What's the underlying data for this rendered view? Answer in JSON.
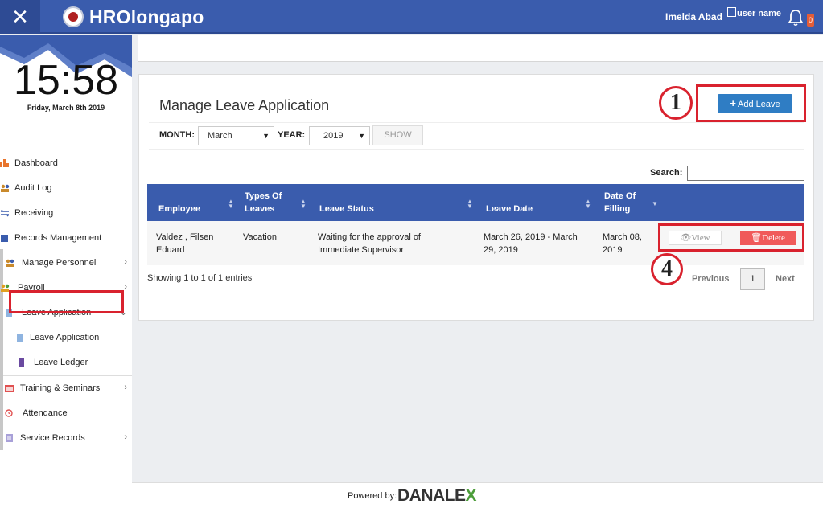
{
  "header": {
    "close_glyph": "✕",
    "app_title": "HROlongapo",
    "user_name": "Imelda Abad",
    "user_image_alt": "user name",
    "notification_count": "0"
  },
  "sidebar": {
    "clock": "15:58",
    "date": "Friday, March 8th 2019",
    "items": [
      {
        "label": "Dashboard",
        "icon": "chart-icon"
      },
      {
        "label": "Audit Log",
        "icon": "users-icon"
      },
      {
        "label": "Receiving",
        "icon": "swap-icon"
      },
      {
        "label": "Records Management",
        "icon": "folder-icon"
      },
      {
        "label": "Manage Personnel",
        "icon": "users-icon"
      },
      {
        "label": "Payroll",
        "icon": "users-icon"
      },
      {
        "label": "Leave Application",
        "icon": "document-icon"
      },
      {
        "label": "Leave Application",
        "icon": "document-icon"
      },
      {
        "label": "Leave Ledger",
        "icon": "book-icon"
      },
      {
        "label": "Training & Seminars",
        "icon": "calendar-icon"
      },
      {
        "label": "Attendance",
        "icon": "clock-icon"
      },
      {
        "label": "Service Records",
        "icon": "list-icon"
      }
    ]
  },
  "main": {
    "title": "Manage Leave Application",
    "add_button": "Add Leave",
    "annotations": [
      "1",
      "4"
    ],
    "filter": {
      "month_label": "MONTH:",
      "month_value": "March",
      "year_label": "YEAR:",
      "year_value": "2019",
      "show_button": "SHOW"
    },
    "search_label": "Search:",
    "table": {
      "headers": [
        "Employee",
        "Types Of Leaves",
        "Leave Status",
        "Leave Date",
        "Date Of Filling"
      ],
      "rows": [
        {
          "employee": "Valdez , Filsen Eduard",
          "type": "Vacation",
          "status": "Waiting for the approval of Immediate Supervisor",
          "leave_date": "March 26, 2019 - March 29, 2019",
          "filing_date": "March 08, 2019",
          "view_label": "View",
          "delete_label": "Delete"
        }
      ]
    },
    "entries_info": "Showing 1 to 1 of 1 entries",
    "pagination": {
      "previous": "Previous",
      "page": "1",
      "next": "Next"
    }
  },
  "footer": {
    "powered_by": "Powered by:",
    "brand_main": "DANALE",
    "brand_x": "X"
  },
  "colors": {
    "primary": "#3a5cad",
    "button_blue": "#2f7dc4",
    "delete_red": "#f05a5a",
    "annotation_red": "#d9222e"
  }
}
